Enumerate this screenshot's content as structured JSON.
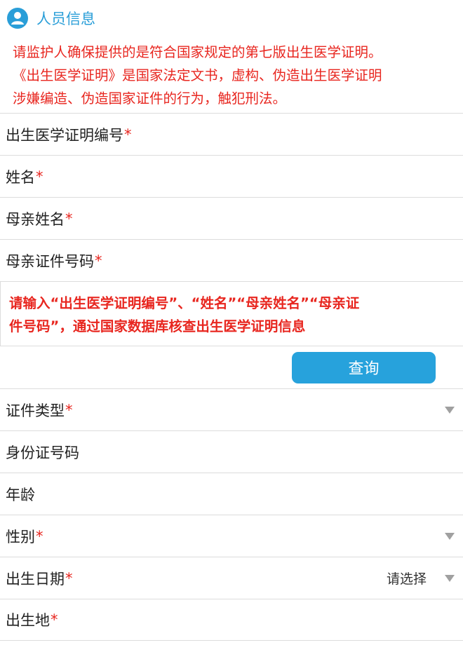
{
  "header": {
    "title": "人员信息",
    "icon": "person-icon",
    "accent": "#2a9ed8"
  },
  "notice": {
    "lines": [
      "请监护人确保提供的是符合国家规定的第七版出生医学证明。",
      "《出生医学证明》是国家法定文书，虚构、伪造出生医学证明",
      "涉嫌编造、伪造国家证件的行为，触犯刑法。"
    ],
    "color": "#e8261f"
  },
  "fields_top": [
    {
      "label": "出生医学证明编号",
      "required": "*",
      "value": ""
    },
    {
      "label": "姓名",
      "required": "*",
      "value": ""
    },
    {
      "label": "母亲姓名",
      "required": "*",
      "value": ""
    },
    {
      "label": "母亲证件号码",
      "required": "*",
      "value": ""
    }
  ],
  "hint": {
    "lines": [
      "请输入“出生医学证明编号”、“姓名”“母亲姓名”“母亲证",
      "件号码”，通过国家数据库核查出生医学证明信息"
    ]
  },
  "query_button": {
    "label": "查询",
    "color": "#27a2dc"
  },
  "fields_bottom": [
    {
      "label": "证件类型",
      "required": "*",
      "type": "select",
      "value": ""
    },
    {
      "label": "身份证号码",
      "required": "",
      "type": "input",
      "value": ""
    },
    {
      "label": "年龄",
      "required": "",
      "type": "input",
      "value": ""
    },
    {
      "label": "性别",
      "required": "*",
      "type": "select",
      "value": ""
    },
    {
      "label": "出生日期",
      "required": "*",
      "type": "select",
      "value": "请选择"
    },
    {
      "label": "出生地",
      "required": "*",
      "type": "input",
      "value": ""
    }
  ]
}
